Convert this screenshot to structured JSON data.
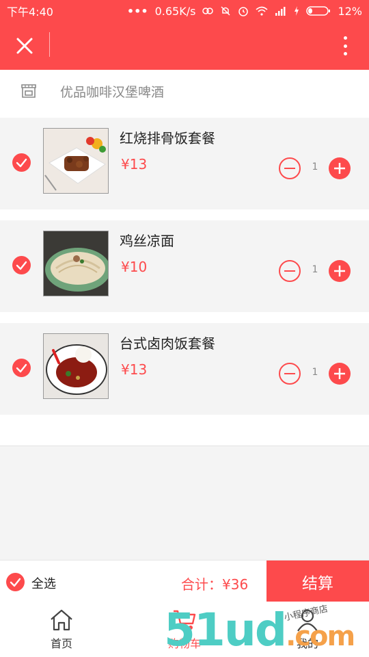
{
  "status_bar": {
    "time": "下午4:40",
    "net_speed": "0.65K/s",
    "battery": "12%"
  },
  "store": {
    "name": "优品咖啡汉堡啤酒",
    "icon": "store-icon"
  },
  "cart_items": [
    {
      "name": "红烧排骨饭套餐",
      "price": "¥13",
      "qty": "1"
    },
    {
      "name": "鸡丝凉面",
      "price": "¥10",
      "qty": "1"
    },
    {
      "name": "台式卤肉饭套餐",
      "price": "¥13",
      "qty": "1"
    }
  ],
  "footer": {
    "select_all": "全选",
    "total": "合计：¥36",
    "checkout": "结算"
  },
  "tabs": [
    {
      "label": "首页",
      "icon": "home-icon"
    },
    {
      "label": "购物车",
      "icon": "cart-icon"
    },
    {
      "label": "我的",
      "icon": "user-icon"
    }
  ],
  "watermark": {
    "big": "51ud",
    "domain": ".com",
    "small": "小程序商店"
  },
  "colors": {
    "accent": "#fd4a4c",
    "background": "#f4f4f4"
  }
}
